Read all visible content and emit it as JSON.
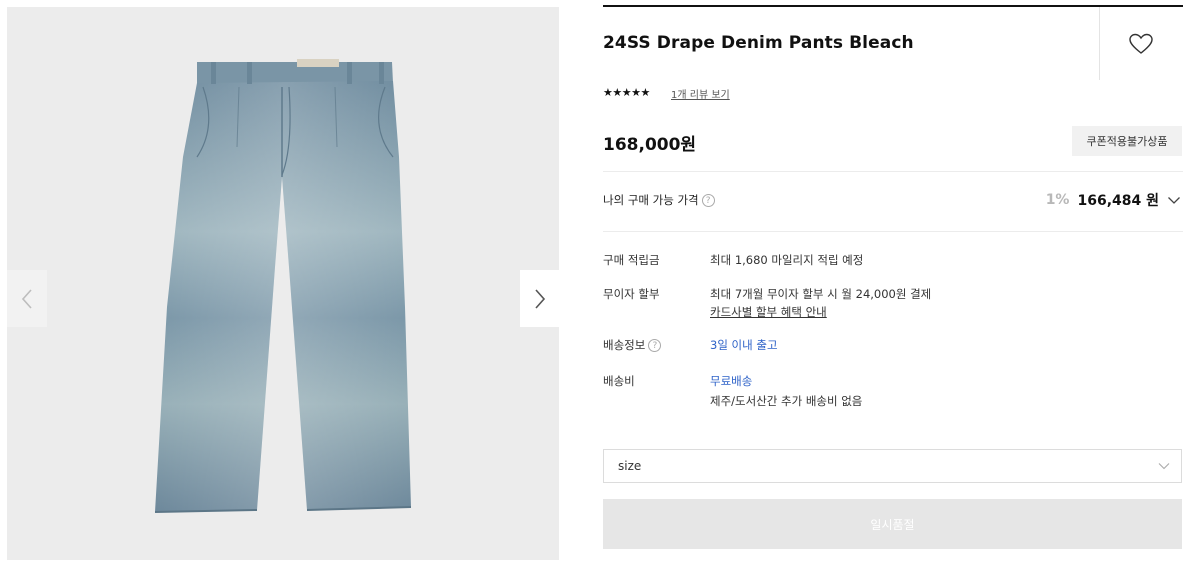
{
  "product": {
    "title": "24SS Drape Denim Pants Bleach",
    "rating_stars": "★★★★★",
    "review_link": "1개 리뷰 보기",
    "price": "168,000원",
    "coupon_badge": "쿠폰적용불가상품"
  },
  "my_price": {
    "label": "나의 구매 가능 가격",
    "help": "?",
    "percent": "1%",
    "amount": "166,484 원"
  },
  "details": {
    "points_label": "구매 적립금",
    "points_value": "최대 1,680 마일리지 적립 예정",
    "installment_label": "무이자 할부",
    "installment_value": "최대 7개월 무이자 할부 시 월 24,000원 결제",
    "installment_link": "카드사별 할부 혜택 안내",
    "shipping_info_label": "배송정보",
    "shipping_info_help": "?",
    "shipping_info_value": "3일 이내 출고",
    "shipping_fee_label": "배송비",
    "shipping_fee_value": "무료배송",
    "shipping_fee_note": "제주/도서산간 추가 배송비 없음"
  },
  "option": {
    "size_placeholder": "size"
  },
  "actions": {
    "soldout_label": "일시품절"
  },
  "colors": {
    "accent_blue": "#2f63c8",
    "denim": "#7f9aac",
    "gallery_bg": "#ececec"
  },
  "icons": {
    "wishlist": "heart-icon",
    "prev": "chevron-left-icon",
    "next": "chevron-right-icon",
    "expand": "chevron-down-icon",
    "help": "question-circle-icon"
  }
}
